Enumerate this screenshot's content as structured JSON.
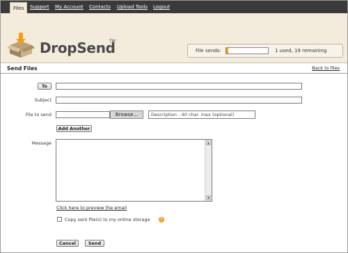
{
  "nav": {
    "tabs": [
      {
        "label": "Files",
        "active": true
      },
      {
        "label": "Support"
      },
      {
        "label": "My Account"
      },
      {
        "label": "Contacts"
      },
      {
        "label": "Upload Tools"
      },
      {
        "label": "Logout"
      }
    ]
  },
  "header": {
    "brand": "DropSend",
    "trademark": "TM",
    "file_sends_label": "File sends:",
    "file_sends_status": "1 used, 19 remaining",
    "usage_fraction": 0.05,
    "accent_color": "#f39c1a"
  },
  "section": {
    "title": "Send Files",
    "back_link": "Back to files"
  },
  "form": {
    "to_button": "To",
    "to_value": "",
    "subject_label": "Subject",
    "subject_value": "",
    "file_label": "File to send",
    "file_value": "",
    "browse_button": "Browse...",
    "description_placeholder": "Description - 40 char. max (optional)",
    "add_another_button": "Add Another",
    "message_label": "Message",
    "message_value": "",
    "preview_link": "Click here to preview the email",
    "storage_checkbox_label": "Copy sent file(s) to my online storage",
    "storage_checked": false,
    "info_icon": "!",
    "cancel_button": "Cancel",
    "send_button": "Send"
  }
}
